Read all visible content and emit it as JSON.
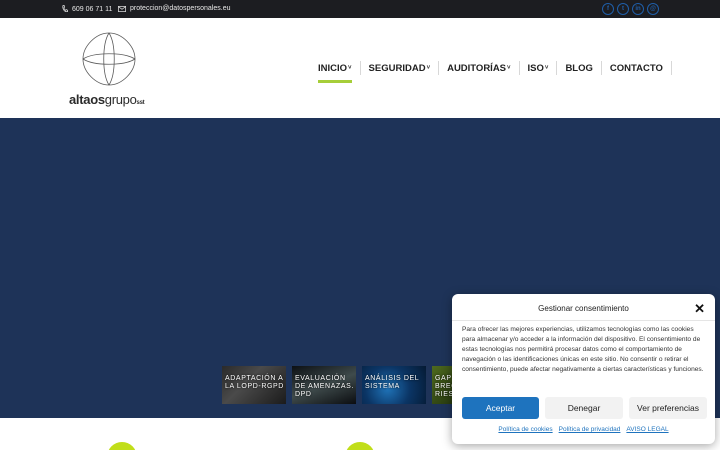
{
  "topbar": {
    "phone": "609 06 71 11",
    "email": "proteccion@datospersonales.eu",
    "socials": [
      {
        "icon": "facebook-icon",
        "glyph": "f"
      },
      {
        "icon": "twitter-icon",
        "glyph": "t"
      },
      {
        "icon": "linkedin-icon",
        "glyph": "in"
      },
      {
        "icon": "mail-icon",
        "glyph": "@"
      }
    ]
  },
  "logo": {
    "bold": "altaos",
    "light": "grupo",
    "suffix": "sst"
  },
  "nav": {
    "items": [
      {
        "label": "INICIO",
        "dropdown": true,
        "active": true
      },
      {
        "label": "SEGURIDAD",
        "dropdown": true
      },
      {
        "label": "AUDITORÍAS",
        "dropdown": true
      },
      {
        "label": "ISO",
        "dropdown": true
      },
      {
        "label": "BLOG",
        "dropdown": false
      },
      {
        "label": "CONTACTO",
        "dropdown": false
      }
    ],
    "chevron": "˅",
    "accent": "#a6ce39"
  },
  "hero": {
    "background": "#1e3358",
    "thumbs": [
      {
        "label": "ADAPTACIÓN A LA LOPD-RGPD"
      },
      {
        "label": "EVALUACIÓN DE AMENAZAS. DPD"
      },
      {
        "label": "ANÁLISIS DEL SISTEMA"
      },
      {
        "label": "GAP BRECHA RIES"
      }
    ]
  },
  "cookie": {
    "title": "Gestionar consentimiento",
    "close": "✕",
    "body": "Para ofrecer las mejores experiencias, utilizamos tecnologías como las cookies para almacenar y/o acceder a la información del dispositivo. El consentimiento de estas tecnologías nos permitirá procesar datos como el comportamiento de navegación o las identificaciones únicas en este sitio. No consentir o retirar el consentimiento, puede afectar negativamente a ciertas características y funciones.",
    "accept": "Aceptar",
    "deny": "Denegar",
    "prefs": "Ver preferencias",
    "links": [
      "Política de cookies",
      "Política de privacidad",
      "AVISO LEGAL"
    ],
    "accent": "#1e73be"
  }
}
